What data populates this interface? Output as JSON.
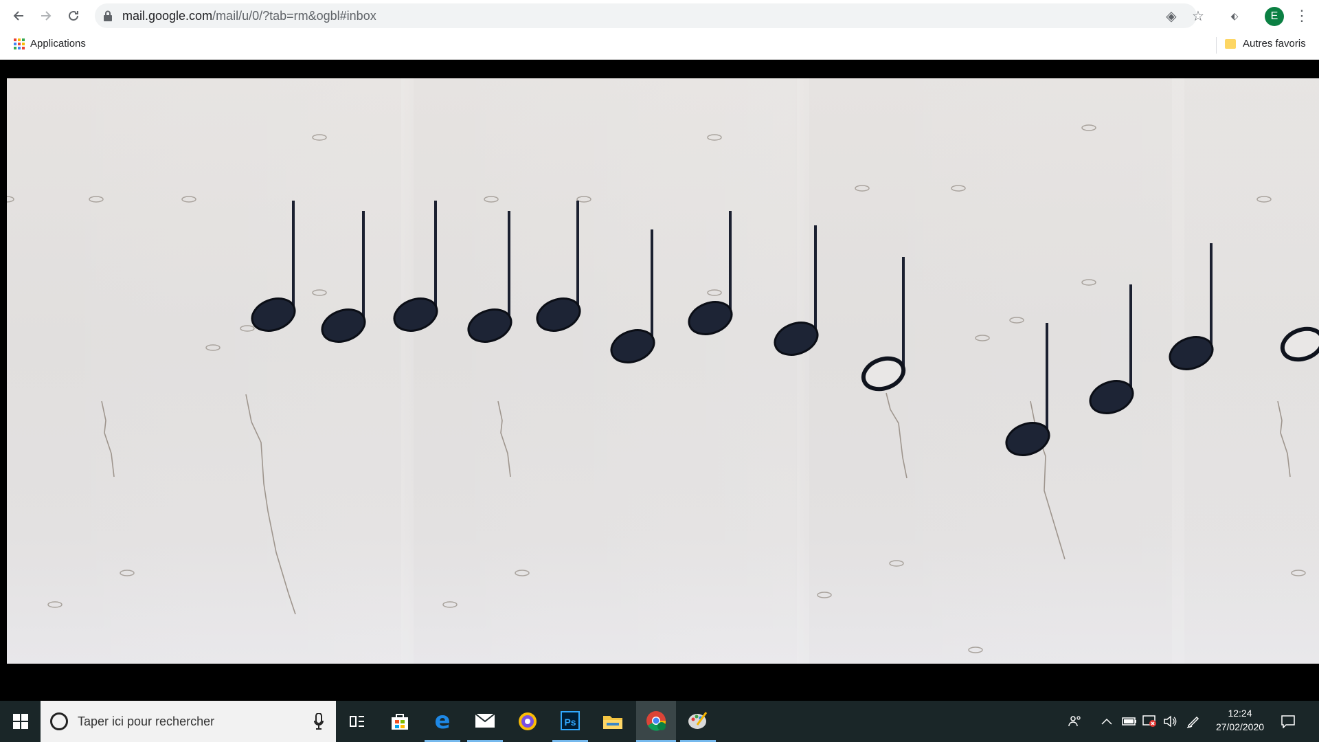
{
  "browser": {
    "url_host": "mail.google.com",
    "url_path": "/mail/u/0/?tab=rm&ogbl#inbox",
    "avatar_letter": "E",
    "bookmarks": {
      "apps_label": "Applications",
      "other_label": "Autres favoris"
    }
  },
  "content": {
    "description_hidden": "",
    "notes": [
      {
        "type": "quarter"
      },
      {
        "type": "quarter"
      },
      {
        "type": "quarter"
      },
      {
        "type": "quarter"
      },
      {
        "type": "quarter"
      },
      {
        "type": "quarter"
      },
      {
        "type": "quarter"
      },
      {
        "type": "quarter"
      },
      {
        "type": "half"
      },
      {
        "type": "quarter"
      },
      {
        "type": "quarter"
      },
      {
        "type": "quarter"
      },
      {
        "type": "half"
      }
    ]
  },
  "taskbar": {
    "search_placeholder": "Taper ici pour rechercher",
    "apps": [
      "task-view-icon",
      "store-icon",
      "edge-icon",
      "mail-icon",
      "brave-icon",
      "photoshop-icon",
      "explorer-icon",
      "chrome-icon",
      "paint-icon"
    ],
    "active_app": "chrome-icon",
    "clock_time": "12:24",
    "clock_date": "27/02/2020",
    "colors": {
      "taskbar_bg": "#1a2628",
      "active_underline": "#76b9ed"
    }
  }
}
